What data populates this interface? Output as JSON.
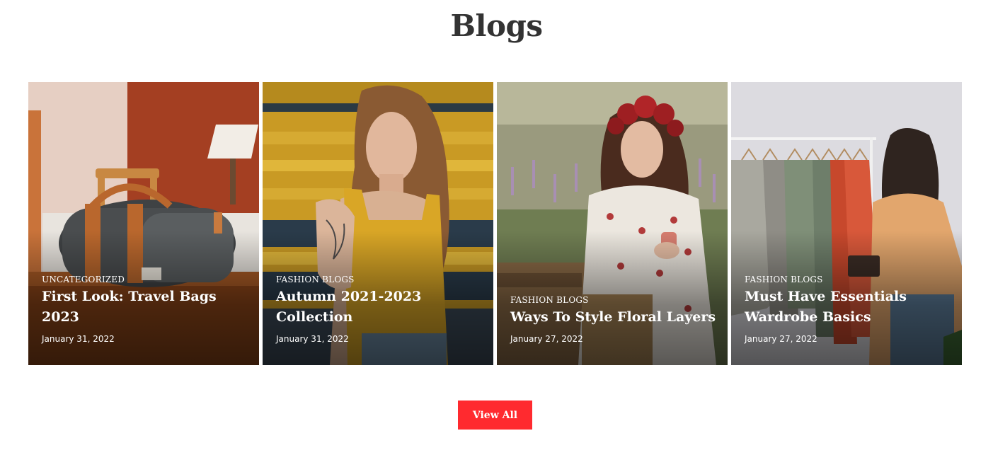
{
  "section": {
    "title": "Blogs"
  },
  "posts": [
    {
      "category": "UNCATEGORIZED",
      "title": "First Look: Travel Bags 2023",
      "date": "January 31, 2022",
      "image_icon": "travel-bag-photo"
    },
    {
      "category": "FASHION BLOGS",
      "title": "Autumn 2021-2023 Collection",
      "date": "January 31, 2022",
      "image_icon": "woman-yellow-top-photo"
    },
    {
      "category": "FASHION BLOGS",
      "title": "Ways To Style Floral Layers",
      "date": "January 27, 2022",
      "image_icon": "floral-dress-field-photo"
    },
    {
      "category": "FASHION BLOGS",
      "title": "Must Have Essentials Wardrobe Basics",
      "date": "January 27, 2022",
      "image_icon": "clothing-rack-photo"
    }
  ],
  "actions": {
    "view_all_label": "View All"
  },
  "colors": {
    "accent": "#ff2a2f",
    "title_text": "#333333",
    "card_text": "#ffffff"
  }
}
